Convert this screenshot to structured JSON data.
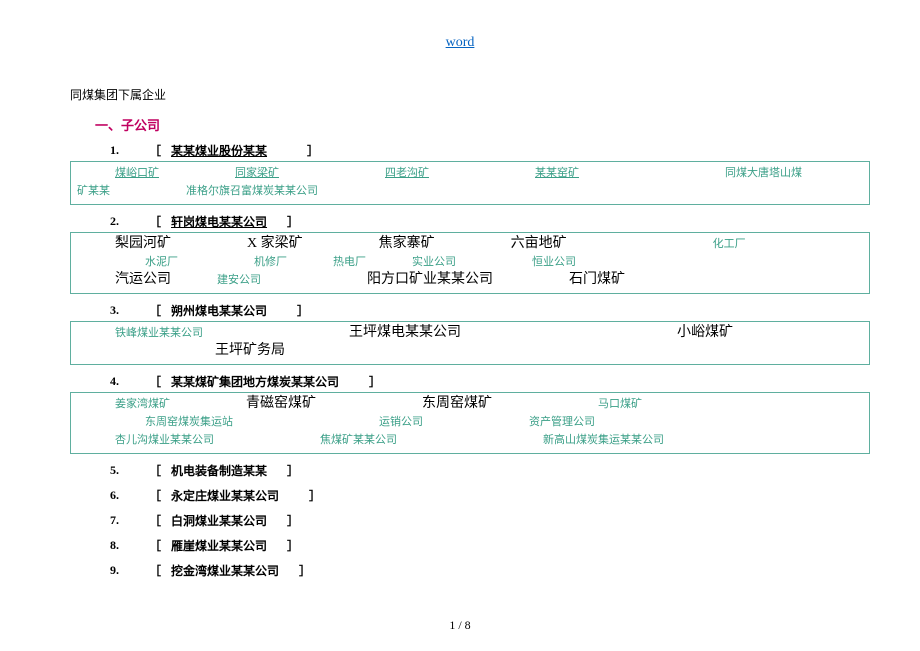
{
  "header": {
    "link_text": "word"
  },
  "title": "同煤集团下属企业",
  "section_heading": "一、子公司",
  "entries": {
    "e1": {
      "num": "1.",
      "br_l": "［",
      "name": "某某煤业股份某某",
      "br_r": "］"
    },
    "e2": {
      "num": "2.",
      "br_l": "［",
      "name": "轩岗煤电某某公司",
      "br_r": "］"
    },
    "e3": {
      "num": "3.",
      "br_l": "［",
      "name": "朔州煤电某某公司",
      "br_r": "］"
    },
    "e4": {
      "num": "4.",
      "br_l": "［",
      "name": "某某煤矿集团地方煤炭某某公司",
      "br_r": "］"
    },
    "e5": {
      "num": "5.",
      "br_l": "［",
      "name": "机电装备制造某某",
      "br_r": "］"
    },
    "e6": {
      "num": "6.",
      "br_l": "［",
      "name": "永定庄煤业某某公司",
      "br_r": "］"
    },
    "e7": {
      "num": "7.",
      "br_l": "［",
      "name": "白洞煤业某某公司",
      "br_r": "］"
    },
    "e8": {
      "num": "8.",
      "br_l": "［",
      "name": "雁崖煤业某某公司",
      "br_r": "］"
    },
    "e9": {
      "num": "9.",
      "br_l": "［",
      "name": "挖金湾煤业某某公司",
      "br_r": "］"
    }
  },
  "box1": {
    "i1": "煤峪口矿",
    "i2": "同家梁矿",
    "i3": "四老沟矿",
    "i4": "某某窑矿",
    "i5": "同煤大唐塔山煤",
    "l2a": "矿某某",
    "l2b": "准格尔旗召富煤炭某某公司"
  },
  "box2": {
    "r1a": "梨园河矿",
    "r1b": "X 家梁矿",
    "r1c": "焦家寨矿",
    "r1d": "六亩地矿",
    "r1e": "化工厂",
    "r2a": "水泥厂",
    "r2b": "机修厂",
    "r2c": "热电厂",
    "r2d": "实业公司",
    "r2e": "恒业公司",
    "r3a": "汽运公司",
    "r3b": "建安公司",
    "r3c": "阳方口矿业某某公司",
    "r3d": "石门煤矿"
  },
  "box3": {
    "r1a": "铁峰煤业某某公司",
    "r1b": "王坪煤电某某公司",
    "r1c": "小峪煤矿",
    "r2a": "王坪矿务局"
  },
  "box4": {
    "r1a": "姜家湾煤矿",
    "r1b": "青磁窑煤矿",
    "r1c": "东周窑煤矿",
    "r1d": "马口煤矿",
    "r2a": "东周窑煤炭集运站",
    "r2b": "运销公司",
    "r2c": "资产管理公司",
    "r3a": "杏儿沟煤业某某公司",
    "r3b": "焦煤矿某某公司",
    "r3c": "新高山煤炭集运某某公司"
  },
  "footer": {
    "page": "1 / 8"
  }
}
